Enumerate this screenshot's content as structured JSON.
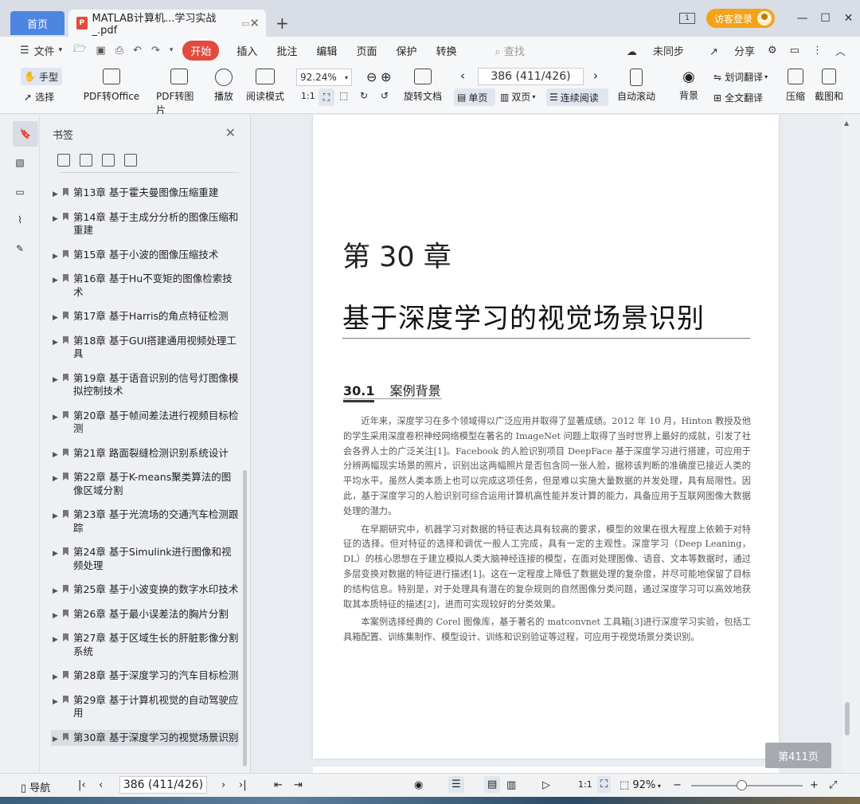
{
  "tabs": {
    "home": "首页",
    "document": "MATLAB计算机...学习实战_.pdf"
  },
  "account": {
    "visitor_login": "访客登录"
  },
  "menu": {
    "file": "文件",
    "items": [
      "开始",
      "插入",
      "批注",
      "编辑",
      "页面",
      "保护",
      "转换"
    ],
    "search_placeholder": "查找",
    "sync": "未同步",
    "share": "分享"
  },
  "ribbon": {
    "hand": "手型",
    "select": "选择",
    "pdf_to_office": "PDF转Office",
    "pdf_to_image": "PDF转图片",
    "play": "播放",
    "read_mode": "阅读模式",
    "zoom": "92.24%",
    "rotate_doc": "旋转文档",
    "page_input": "386 (411/426)",
    "single_page": "单页",
    "double_page": "双页",
    "continuous": "连续阅读",
    "auto_scroll": "自动滚动",
    "background": "背景",
    "word_translate": "划词翻译",
    "full_translate": "全文翻译",
    "compress": "压缩",
    "screenshot": "截图和"
  },
  "bookmarks": {
    "title": "书签",
    "items": [
      "第13章  基于霍夫曼图像压缩重建",
      "第14章  基于主成分分析的图像压缩和重建",
      "第15章  基于小波的图像压缩技术",
      "第16章  基于Hu不变矩的图像检索技术",
      "第17章  基于Harris的角点特征检测",
      "第18章  基于GUI搭建通用视频处理工具",
      "第19章  基于语音识别的信号灯图像模拟控制技术",
      "第20章  基于帧间差法进行视频目标检测",
      "第21章  路面裂缝检测识别系统设计",
      "第22章  基于K-means聚类算法的图像区域分割",
      "第23章  基于光流场的交通汽车检测跟踪",
      "第24章  基于Simulink进行图像和视频处理",
      "第25章  基于小波变换的数字水印技术",
      "第26章  基于最小误差法的胸片分割",
      "第27章  基于区域生长的肝脏影像分割系统",
      "第28章  基于深度学习的汽车目标检测",
      "第29章  基于计算机视觉的自动驾驶应用",
      "第30章  基于深度学习的视觉场景识别"
    ]
  },
  "document": {
    "chapter_number": "第 30 章",
    "chapter_title": "基于深度学习的视觉场景识别",
    "section_number": "30.1",
    "section_title": "案例背景",
    "paragraphs": [
      "近年来，深度学习在多个领域得以广泛应用并取得了显著成绩。2012 年 10 月，Hinton 教授及他的学生采用深度卷积神经网络模型在著名的 ImageNet 问题上取得了当时世界上最好的成就，引发了社会各界人士的广泛关注[1]。Facebook 的人脸识别项目 DeepFace 基于深度学习进行搭建，可应用于分辨两幅现实场景的照片，识别出这两幅照片是否包含同一张人脸，据称该判断的准确度已接近人类的平均水平。虽然人类本质上也可以完成这项任务，但是难以实施大量数据的并发处理，具有局限性。因此，基于深度学习的人脸识别可综合运用计算机高性能并发计算的能力，具备应用于互联网图像大数据处理的潜力。",
      "在早期研究中，机器学习对数据的特征表达具有较高的要求，模型的效果在很大程度上依赖于对特征的选择。但对特征的选择和调优一般人工完成，具有一定的主观性。深度学习（Deep Leaning，DL）的核心思想在于建立模拟人类大脑神经连接的模型，在面对处理图像、语音、文本等数据时，通过多层变换对数据的特征进行描述[1]。这在一定程度上降低了数据处理的复杂度，并尽可能地保留了目标的结构信息。特别是，对于处理具有潜在的复杂规则的自然图像分类问题，通过深度学习可以高效地获取其本质特征的描述[2]，进而可实现较好的分类效果。",
      "本案例选择经典的 Corel 图像库，基于著名的 matconvnet 工具箱[3]进行深度学习实验，包括工具箱配置、训练集制作、模型设计、训练和识别验证等过程，可应用于视觉场景分类识别。"
    ],
    "page_indicator": "第411页"
  },
  "statusbar": {
    "nav": "导航",
    "page_input": "386 (411/426)",
    "zoom": "92%"
  }
}
